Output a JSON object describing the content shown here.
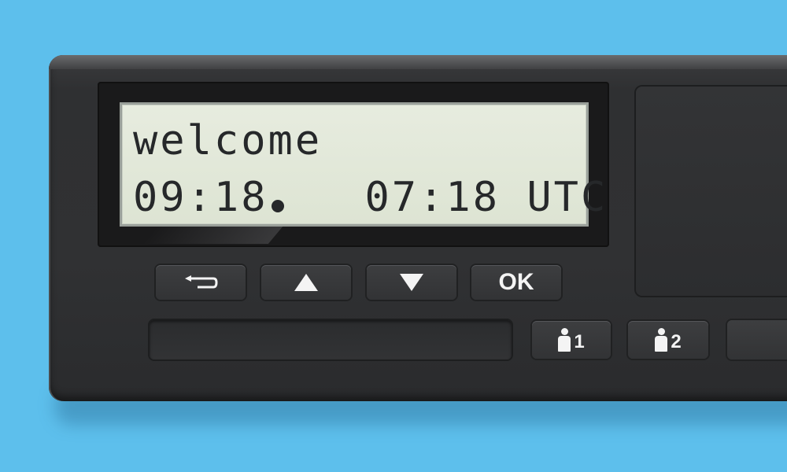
{
  "display": {
    "line1": "welcome",
    "local_time": "09:18",
    "utc_time": "07:18",
    "utc_label": "UTC"
  },
  "buttons": {
    "back": {
      "icon": "return-arrow-icon"
    },
    "up": {
      "icon": "arrow-up-icon"
    },
    "down": {
      "icon": "arrow-down-icon"
    },
    "ok": {
      "label": "OK"
    },
    "driver1": {
      "icon": "driver-icon",
      "label": "1"
    },
    "driver2": {
      "icon": "driver-icon",
      "label": "2"
    }
  },
  "colors": {
    "background": "#5dbfec",
    "device_body": "#303133",
    "lcd_background": "#e2e8d9",
    "lcd_text": "#26282a",
    "button_glyph": "#f4f4f4"
  }
}
